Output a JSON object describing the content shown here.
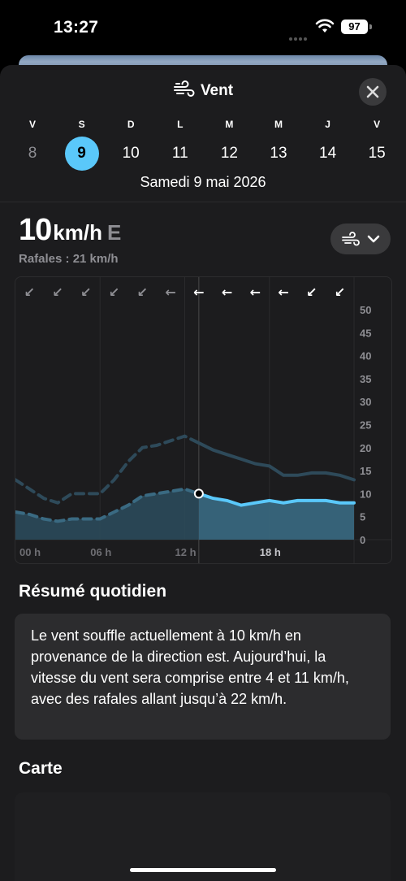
{
  "status": {
    "time": "13:27",
    "battery": "97"
  },
  "header": {
    "title": "Vent",
    "close_icon": "close-icon",
    "title_icon": "wind-icon"
  },
  "days": [
    {
      "letter": "V",
      "number": "8",
      "state": "past"
    },
    {
      "letter": "S",
      "number": "9",
      "state": "selected"
    },
    {
      "letter": "D",
      "number": "10",
      "state": "future"
    },
    {
      "letter": "L",
      "number": "11",
      "state": "future"
    },
    {
      "letter": "M",
      "number": "12",
      "state": "future"
    },
    {
      "letter": "M",
      "number": "13",
      "state": "future"
    },
    {
      "letter": "J",
      "number": "14",
      "state": "future"
    },
    {
      "letter": "V",
      "number": "15",
      "state": "future"
    }
  ],
  "date_label": "Samedi 9 mai 2026",
  "current": {
    "speed": "10",
    "unit": "km/h",
    "direction": "E",
    "gusts": "Rafales : 21 km/h"
  },
  "layer_button": {
    "icon": "wind-icon",
    "chevron": "chevron-down-icon"
  },
  "chart_data": {
    "type": "area",
    "x_labels": [
      "00 h",
      "06 h",
      "12 h",
      "18 h"
    ],
    "y_ticks": [
      "0",
      "5",
      "10",
      "15",
      "20",
      "25",
      "30",
      "35",
      "40",
      "45",
      "50"
    ],
    "ylim": [
      0,
      50
    ],
    "xlim": [
      0,
      24
    ],
    "now_hour": 13,
    "direction_arrows": [
      "↙",
      "↙",
      "↙",
      "↙",
      "↙",
      "←",
      "←",
      "←",
      "←",
      "←",
      "↙",
      "↙"
    ],
    "arrow_hours": [
      1,
      3,
      5,
      7,
      9,
      11,
      13,
      15,
      17,
      19,
      21,
      23
    ],
    "series": [
      {
        "kind": "gusts",
        "x": [
          0,
          1,
          2,
          3,
          4,
          5,
          6,
          7,
          8,
          9,
          10,
          11,
          12,
          13,
          14,
          15,
          16,
          17,
          18,
          19,
          20,
          21,
          22,
          23,
          24
        ],
        "values": [
          13,
          11,
          9,
          8,
          10,
          10,
          10,
          13,
          17,
          20,
          20.5,
          21.5,
          22.5,
          21,
          19.5,
          18.5,
          17.5,
          16.5,
          16,
          14,
          14,
          14.5,
          14.5,
          14,
          13
        ]
      },
      {
        "kind": "speed",
        "x": [
          0,
          1,
          2,
          3,
          4,
          5,
          6,
          7,
          8,
          9,
          10,
          11,
          12,
          13,
          14,
          15,
          16,
          17,
          18,
          19,
          20,
          21,
          22,
          23,
          24
        ],
        "values": [
          6,
          5.5,
          4.5,
          4,
          4.5,
          4.5,
          4.5,
          6,
          7.5,
          9.5,
          10,
          10.5,
          11,
          10,
          9,
          8.5,
          7.5,
          8,
          8.5,
          8,
          8.5,
          8.5,
          8.5,
          8,
          8
        ]
      }
    ]
  },
  "summary": {
    "title": "Résumé quotidien",
    "text": "Le vent souffle actuellement à 10 km/h en provenance de la direction est. Aujourd’hui, la vitesse du vent sera comprise entre 4 et 11 km/h, avec des rafales allant jusqu’à 22 km/h."
  },
  "map": {
    "title": "Carte"
  },
  "colors": {
    "accent": "#5ac8fa",
    "gust": "#2e4a5a",
    "area": "#3a6a82"
  }
}
